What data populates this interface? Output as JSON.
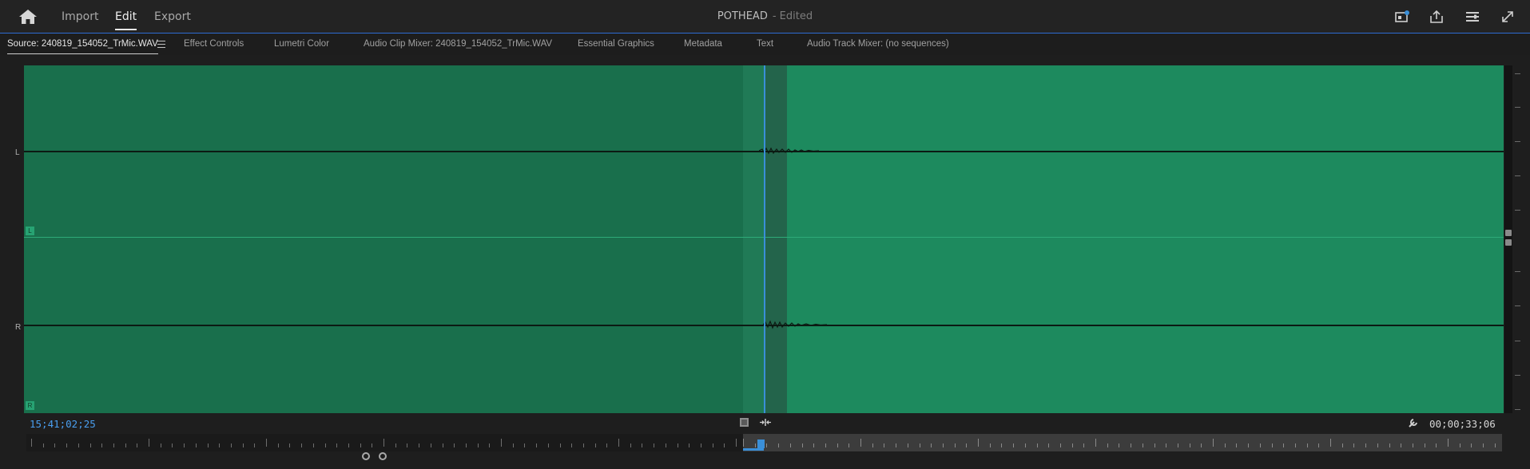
{
  "topbar": {
    "home_icon": "home-icon",
    "nav": [
      {
        "label": "Import",
        "active": false
      },
      {
        "label": "Edit",
        "active": true
      },
      {
        "label": "Export",
        "active": false
      }
    ],
    "project_title": "POTHEAD",
    "project_status": "- Edited",
    "right_icons": [
      "quick-export-icon",
      "share-icon",
      "workspaces-menu-icon",
      "fullscreen-icon"
    ]
  },
  "tabs": [
    {
      "label": "Source: 240819_154052_TrMic.WAV",
      "active": true
    },
    {
      "label": "Effect Controls",
      "active": false
    },
    {
      "label": "Lumetri Color",
      "active": false
    },
    {
      "label": "Audio Clip Mixer: 240819_154052_TrMic.WAV",
      "active": false
    },
    {
      "label": "Essential Graphics",
      "active": false
    },
    {
      "label": "Metadata",
      "active": false
    },
    {
      "label": "Text",
      "active": false
    },
    {
      "label": "Audio Track Mixer: (no sequences)",
      "active": false
    }
  ],
  "waveform": {
    "channels": [
      {
        "side_label": "L",
        "tag": "L"
      },
      {
        "side_label": "R",
        "tag": "R"
      }
    ],
    "colors": {
      "waveform_bg": "#1d8a5e",
      "waveform_dim": "#196f4c",
      "playhead": "#3a8fd8"
    }
  },
  "controls": {
    "current_timecode": "15;41;02;25",
    "duration_timecode": "00;00;33;06",
    "buttons": [
      "add-marker-icon",
      "insert-icon",
      "wrench-icon"
    ]
  }
}
